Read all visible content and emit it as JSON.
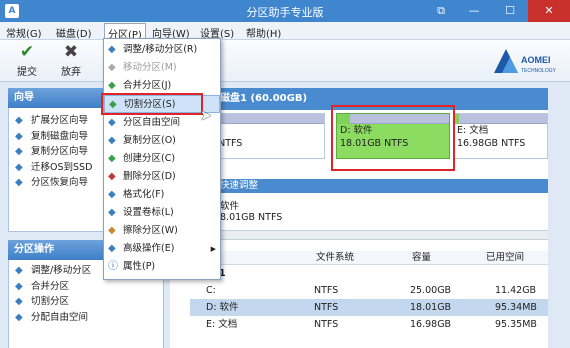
{
  "window": {
    "app_icon": "A",
    "title": "分区助手专业版",
    "buttons": {
      "restore": "⧉",
      "minimize": "—",
      "maximize": "☐",
      "close": "✕"
    }
  },
  "menubar": [
    "常规(G)",
    "磁盘(D)",
    "分区(P)",
    "向导(W)",
    "设置(S)",
    "帮助(H)"
  ],
  "toolbar": {
    "commit": {
      "label": "提交",
      "icon": "check-icon"
    },
    "discard": {
      "label": "放弃",
      "icon": "x-icon"
    }
  },
  "logo": {
    "brand": "AOMEI",
    "tagline": "TECHNOLOGY"
  },
  "sidebar": {
    "wizard_title": "向导",
    "wizard_items": [
      "扩展分区向导",
      "复制磁盘向导",
      "复制分区向导",
      "迁移OS到SSD",
      "分区恢复向导"
    ],
    "ops_title": "分区操作",
    "ops_items": [
      "调整/移动分区",
      "合并分区",
      "切割分区",
      "分配自由空间"
    ]
  },
  "dropdown": [
    {
      "label": "调整/移动分区(R)",
      "icon": "resize-icon",
      "disabled": false
    },
    {
      "label": "移动分区(M)",
      "icon": "move-icon",
      "disabled": true
    },
    {
      "label": "合并分区(J)",
      "icon": "merge-icon",
      "disabled": false
    },
    {
      "label": "切割分区(S)",
      "icon": "split-icon",
      "disabled": false
    },
    {
      "label": "分区自由空间",
      "icon": "free-space-icon",
      "disabled": false
    },
    {
      "label": "复制分区(O)",
      "icon": "copy-icon",
      "disabled": false
    },
    {
      "label": "创建分区(C)",
      "icon": "create-icon",
      "disabled": false
    },
    {
      "label": "删除分区(D)",
      "icon": "delete-icon",
      "disabled": false
    },
    {
      "label": "格式化(F)",
      "icon": "format-icon",
      "disabled": false
    },
    {
      "label": "设置卷标(L)",
      "icon": "label-icon",
      "disabled": false
    },
    {
      "label": "擦除分区(W)",
      "icon": "wipe-icon",
      "disabled": false
    },
    {
      "label": "高级操作(E)",
      "icon": "advanced-icon",
      "disabled": false,
      "submenu": true
    },
    {
      "label": "属性(P)",
      "icon": "info-icon",
      "disabled": false
    }
  ],
  "disk": {
    "header": "磁盘1 (60.00GB)",
    "partitions": [
      {
        "name": "",
        "size": "25.00GB NTFS",
        "used_fraction": 0.3
      },
      {
        "name": "D: 软件",
        "size": "18.01GB NTFS",
        "used_fraction": 0.12
      },
      {
        "name": "E: 文档",
        "size": "16.98GB NTFS",
        "used_fraction": 0.05
      }
    ]
  },
  "quick": {
    "title": "快速调整",
    "partition_name": "软件",
    "partition_size": "8.01GB NTFS"
  },
  "table": {
    "columns": [
      "",
      "文件系统",
      "容量",
      "已用空间"
    ],
    "group": "磁盘1",
    "rows": [
      {
        "name": "C:",
        "fs": "NTFS",
        "capacity": "25.00GB",
        "used": "11.42GB",
        "selected": false
      },
      {
        "name": "D: 软件",
        "fs": "NTFS",
        "capacity": "18.01GB",
        "used": "95.34MB",
        "selected": true
      },
      {
        "name": "E: 文档",
        "fs": "NTFS",
        "capacity": "16.98GB",
        "used": "95.35MB",
        "selected": false
      }
    ]
  },
  "colors": {
    "titlebar": "#3f86cf",
    "used_bar": "#7fd35a",
    "highlight": "#e0252a"
  }
}
